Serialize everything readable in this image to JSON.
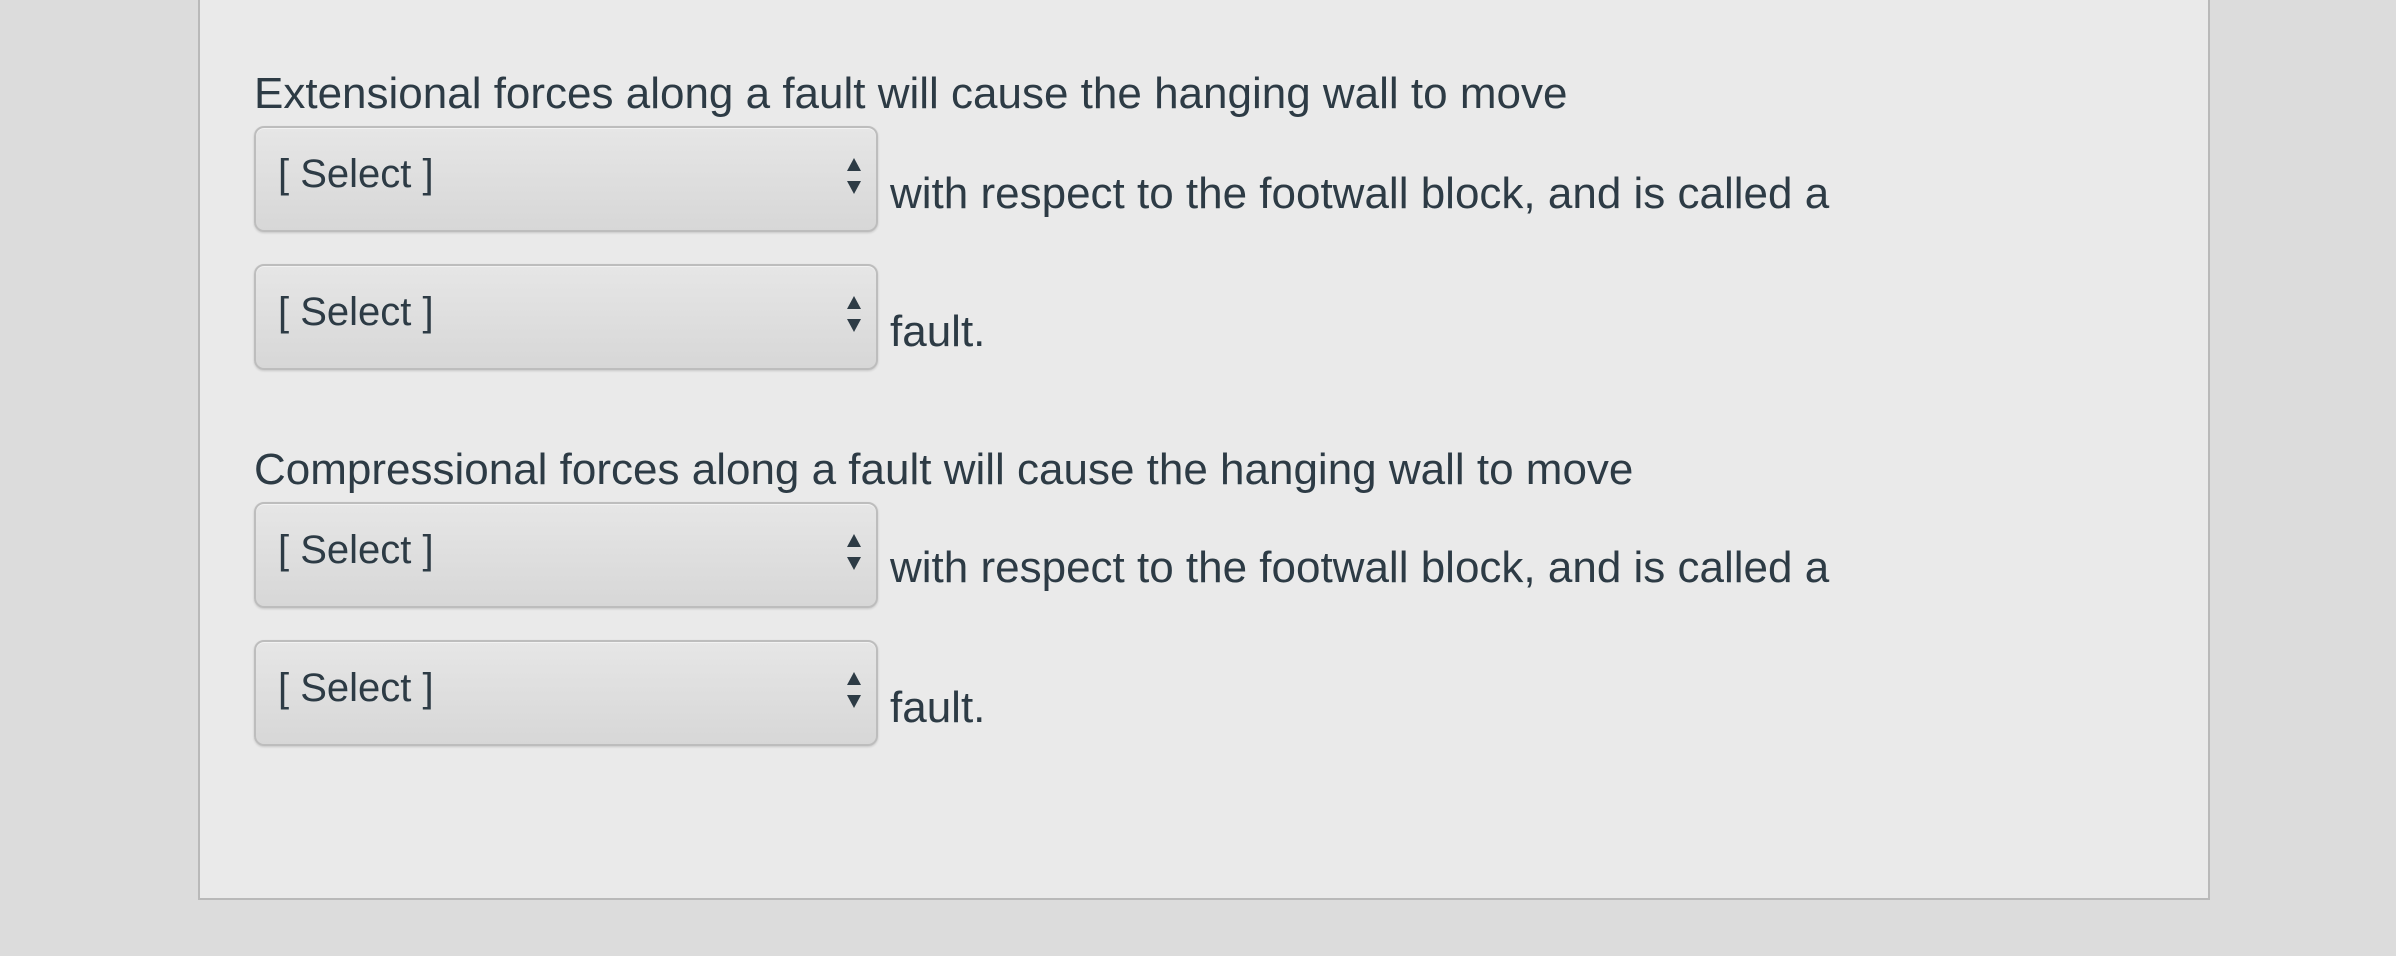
{
  "questions": [
    {
      "prompt": "Extensional forces along a fault will cause the hanging wall to move",
      "dropdown_1": {
        "selected": "[ Select ]"
      },
      "text_1": "with respect to the footwall block, and is called a",
      "dropdown_2": {
        "selected": "[ Select ]"
      },
      "text_2": "fault."
    },
    {
      "prompt": "Compressional forces along a fault will cause the hanging wall to move",
      "dropdown_1": {
        "selected": "[ Select ]"
      },
      "text_1": "with respect to the footwall block, and is called a",
      "dropdown_2": {
        "selected": "[ Select ]"
      },
      "text_2": "fault."
    }
  ],
  "icons": {
    "select_arrow": "up-down-arrows-icon"
  },
  "colors": {
    "text": "#2d3b45",
    "card_background": "#eaeaea",
    "page_background": "#dcdcdc"
  }
}
